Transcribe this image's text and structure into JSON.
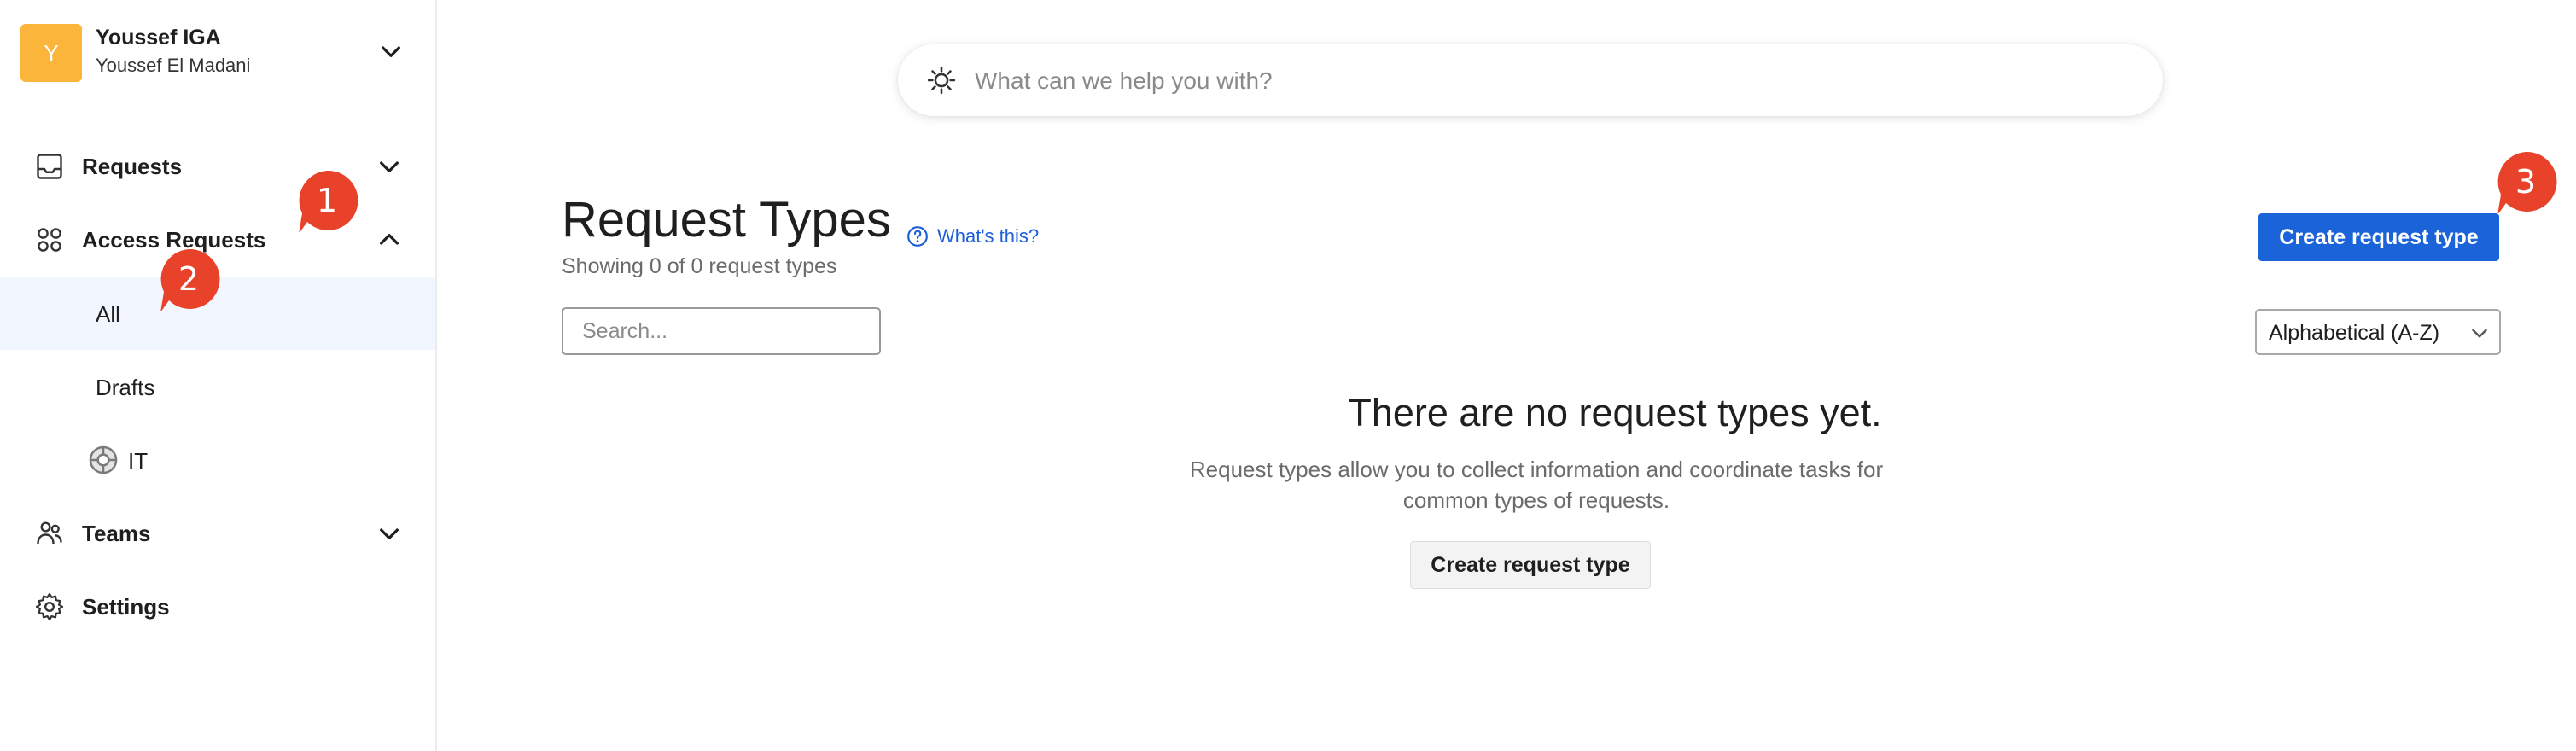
{
  "workspace": {
    "avatar_initial": "Y",
    "name": "Youssef IGA",
    "user": "Youssef El Madani"
  },
  "sidebar": {
    "items": [
      {
        "label": "Requests",
        "icon": "inbox-icon",
        "expanded": false
      },
      {
        "label": "Access Requests",
        "icon": "grid-circles-icon",
        "expanded": true,
        "children": [
          {
            "label": "All",
            "active": true
          },
          {
            "label": "Drafts",
            "active": false
          },
          {
            "label": "IT",
            "icon": "life-ring-icon",
            "active": false
          }
        ]
      },
      {
        "label": "Teams",
        "icon": "people-icon",
        "expanded": false
      },
      {
        "label": "Settings",
        "icon": "gear-icon"
      }
    ]
  },
  "search": {
    "placeholder": "What can we help you with?",
    "icon": "sun-spinner-icon"
  },
  "main": {
    "title": "Request Types",
    "whats_this": "What's this?",
    "subtitle": "Showing 0 of 0 request types",
    "create_button": "Create request type",
    "list_search_placeholder": "Search...",
    "sort": {
      "selected": "Alphabetical (A-Z)"
    },
    "empty": {
      "title": "There are no request types yet.",
      "description": "Request types allow you to collect information and coordinate tasks for common types of requests.",
      "button": "Create request type"
    }
  },
  "annotations": [
    {
      "number": "1"
    },
    {
      "number": "2"
    },
    {
      "number": "3"
    }
  ],
  "colors": {
    "accent": "#1b63d8",
    "avatar": "#fbb53b",
    "badge": "#e8432a",
    "active_bg": "#f2f6ff"
  }
}
